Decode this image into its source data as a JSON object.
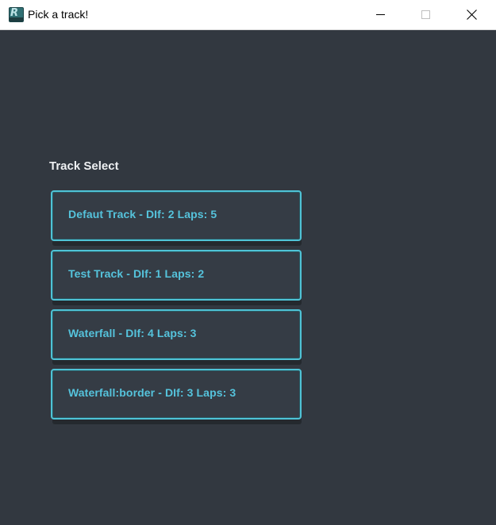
{
  "window": {
    "title": "Pick a track!",
    "app_icon": "race-game-icon",
    "controls": {
      "minimize_icon": "minimize-icon",
      "maximize_icon": "maximize-icon",
      "close_icon": "close-icon"
    }
  },
  "main": {
    "section_title": "Track Select",
    "tracks": [
      {
        "label": "Defaut Track - DIf: 2 Laps: 5"
      },
      {
        "label": "Test Track - DIf: 1 Laps: 2"
      },
      {
        "label": "Waterfall - DIf: 4 Laps: 3"
      },
      {
        "label": "Waterfall:border - DIf: 3 Laps: 3"
      }
    ]
  },
  "colors": {
    "background": "#323840",
    "button_face": "#353c45",
    "button_border": "#4fc3d6",
    "button_text": "#55c3dc",
    "title_text": "#eef0f2"
  }
}
